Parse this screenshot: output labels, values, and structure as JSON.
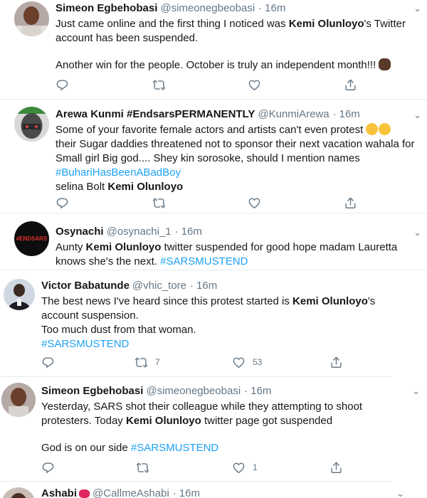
{
  "tweets": [
    {
      "name": "Simeon Egbehobasi",
      "handle": "@simeonegbeobasi",
      "dot": "·",
      "time": "16m",
      "lines": [
        {
          "pre": "Just came online and the first thing I noticed was ",
          "kw": "Kemi Olunloyo",
          "post": "'s Twitter"
        },
        {
          "pre": "account has been suspended.",
          "kw": "",
          "post": ""
        },
        {
          "pre": "Another win for the people. October is truly an independent month!!! ",
          "kw": "",
          "post": ""
        }
      ],
      "emoji": "raised-fist",
      "actions": {
        "reply": "",
        "retweet": "",
        "like": "",
        "share": ""
      }
    },
    {
      "name": "Arewa Kunmi #EndsarsPERMANENTLY",
      "handle": "@KunmiArewa",
      "dot": "·",
      "time": "16m",
      "lines": [
        "Some of your favorite female actors and artists can't even protest",
        "their Sugar daddies threatened not to sponsor their next vacation wahala for",
        "Small girl Big god.... Shey kin sorosoke, should I mention names"
      ],
      "hashtag": "#BuhariHasBeenABadBoy",
      "last_pre": " selina Bolt ",
      "last_kw": "Kemi Olunloyo"
    },
    {
      "name": "Osynachi",
      "handle": "@osynachi_1",
      "dot": "·",
      "time": "16m",
      "avatar_text": "#ENDSARS",
      "line1_pre": "Aunty ",
      "line1_kw": "Kemi Olunloyo",
      "line1_post": " twitter suspended for good hope madam Lauretta",
      "line2_pre": "knows she's the next. ",
      "hashtag": "#SARSMUSTEND"
    },
    {
      "name": "Victor Babatunde",
      "handle": "@vhic_tore",
      "dot": "·",
      "time": "16m",
      "line1_pre": "The best news I've heard since this protest started is ",
      "line1_kw": "Kemi Olunloyo",
      "line1_post": "'s",
      "line2": "account suspension.",
      "line3": "Too much dust from that woman.",
      "hashtag": "#SARSMUSTEND",
      "retweets": "7",
      "likes": "53"
    },
    {
      "name": "Simeon Egbehobasi",
      "handle": "@simeonegbeobasi",
      "dot": "·",
      "time": "16m",
      "line1": "Yesterday, SARS shot their colleague while they attempting to shoot",
      "line2_pre": "protesters. Today ",
      "line2_kw": "Kemi Olunloyo",
      "line2_post": " twitter page got suspended",
      "line3_pre": "God is on our side ",
      "hashtag": "#SARSMUSTEND",
      "likes": "1"
    },
    {
      "name": "Ashabi",
      "handle": "@CallmeAshabi",
      "dot": "·",
      "time": "16m"
    }
  ],
  "colors": {
    "link": "#1da1f2",
    "muted": "#657786",
    "text": "#14171a",
    "divider": "#e6ecf0"
  },
  "icons": [
    "reply-icon",
    "retweet-icon",
    "like-icon",
    "share-icon",
    "chevron-down-icon",
    "raised-fist-emoji",
    "laughing-emoji",
    "lips-emoji"
  ]
}
